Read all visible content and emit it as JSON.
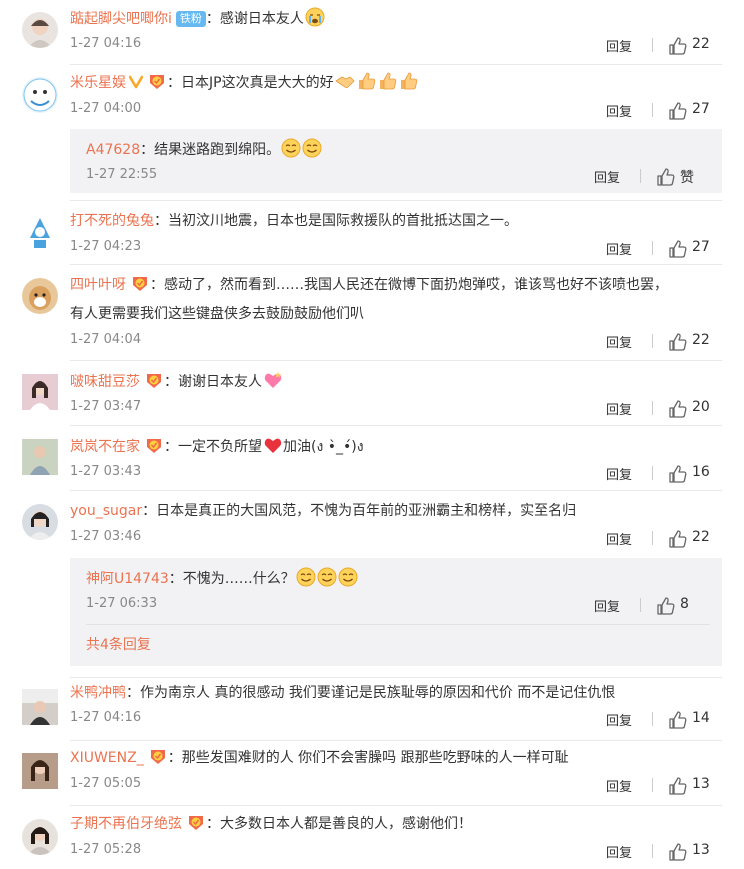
{
  "comments": [
    {
      "user": "踮起脚尖吧唧你i",
      "badge": "铁粉",
      "text": "：感谢日本友人",
      "time": "1-27 04:16",
      "reply": "回复",
      "likes": "22"
    },
    {
      "user": "米乐星娱",
      "text": "：日本JP这次真是大大的好",
      "time": "1-27 04:00",
      "reply": "回复",
      "likes": "27",
      "sub": {
        "user": "A47628",
        "text": "：结果迷路跑到绵阳。",
        "time": "1-27 22:55",
        "reply": "回复",
        "likes": "赞"
      }
    },
    {
      "user": "打不死的兔兔",
      "text": "：当初汶川地震，日本也是国际救援队的首批抵达国之一。",
      "time": "1-27 04:23",
      "reply": "回复",
      "likes": "27"
    },
    {
      "user": "四叶叶呀",
      "text": "：感动了，然而看到……我国人民还在微博下面扔炮弹哎，谁该骂也好不该喷也罢，",
      "text2": "有人更需要我们这些键盘侠多去鼓励鼓励他们叭",
      "time": "1-27 04:04",
      "reply": "回复",
      "likes": "22"
    },
    {
      "user": "啵味甜豆莎",
      "text": "：谢谢日本友人",
      "time": "1-27 03:47",
      "reply": "回复",
      "likes": "20"
    },
    {
      "user": "岚岚不在家",
      "text": "：一定不负所望",
      "text_after": "加油(ง •̀_•́)ง",
      "time": "1-27 03:43",
      "reply": "回复",
      "likes": "16"
    },
    {
      "user": "you_sugar",
      "text": "：日本是真正的大国风范，不愧为百年前的亚洲霸主和榜样，实至名归",
      "time": "1-27 03:46",
      "reply": "回复",
      "likes": "22",
      "sub": {
        "user": "神阿U14743",
        "text": "：不愧为……什么？",
        "time": "1-27 06:33",
        "reply": "回复",
        "likes": "8",
        "more": "共4条回复"
      }
    },
    {
      "user": "米鸭冲鸭",
      "text": "：作为南京人 真的很感动 我们要谨记是民族耻辱的原因和代价 而不是记住仇恨",
      "time": "1-27 04:16",
      "reply": "回复",
      "likes": "14"
    },
    {
      "user": "XIUWENZ_",
      "text": "：那些发国难财的人 你们不会害臊吗 跟那些吃野味的人一样可耻",
      "time": "1-27 05:05",
      "reply": "回复",
      "likes": "13"
    },
    {
      "user": "子期不再伯牙绝弦",
      "text": "：大多数日本人都是善良的人，感谢他们！",
      "time": "1-27 05:28",
      "reply": "回复",
      "likes": "13"
    }
  ],
  "colors": {
    "username": "#eb7350",
    "text": "#333333",
    "time": "#888888",
    "reply_bg": "#f2f2f5"
  },
  "icons": {
    "like": "thumbs-up-icon",
    "vip": "v-badge-icon",
    "medal": "fan-medal-icon"
  }
}
